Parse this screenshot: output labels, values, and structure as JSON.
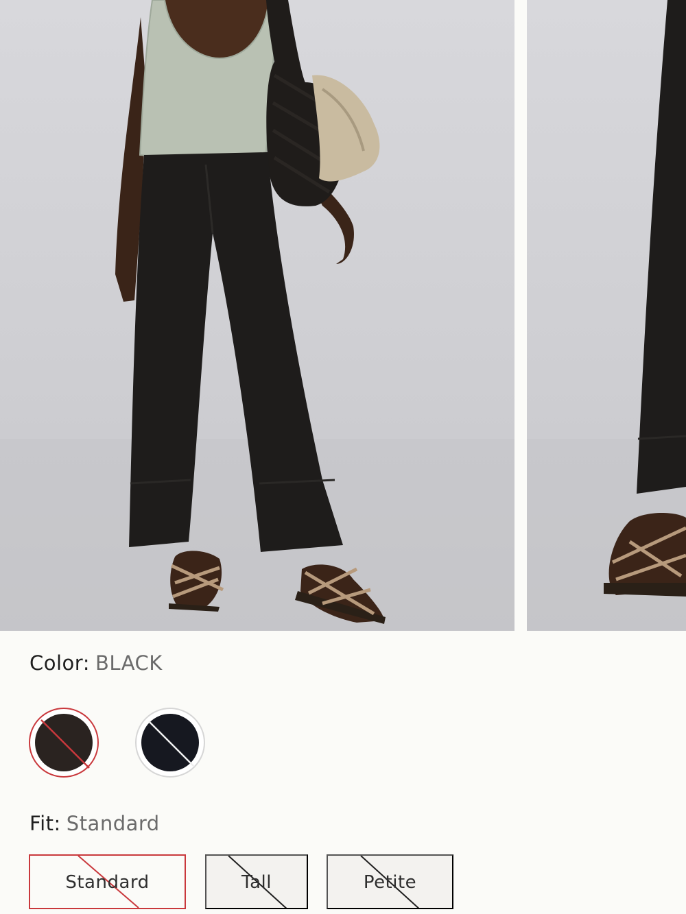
{
  "gallery": {
    "images": [
      {
        "alt_icon": "model-photo-front"
      },
      {
        "alt_icon": "model-photo-side"
      }
    ]
  },
  "color": {
    "label": "Color:",
    "selected": "BLACK",
    "swatches": [
      {
        "color": "#2a2320",
        "selected": true,
        "unavailable": true
      },
      {
        "color": "#161820",
        "selected": false,
        "unavailable": true
      }
    ]
  },
  "fit": {
    "label": "Fit:",
    "selected": "Standard",
    "options": [
      {
        "label": "Standard",
        "selected": true,
        "unavailable": true
      },
      {
        "label": "Tall",
        "selected": false,
        "unavailable": true
      },
      {
        "label": "Petite",
        "selected": false,
        "unavailable": true
      }
    ]
  },
  "colors": {
    "accent": "#c9383c",
    "background": "#fbfbf8"
  }
}
